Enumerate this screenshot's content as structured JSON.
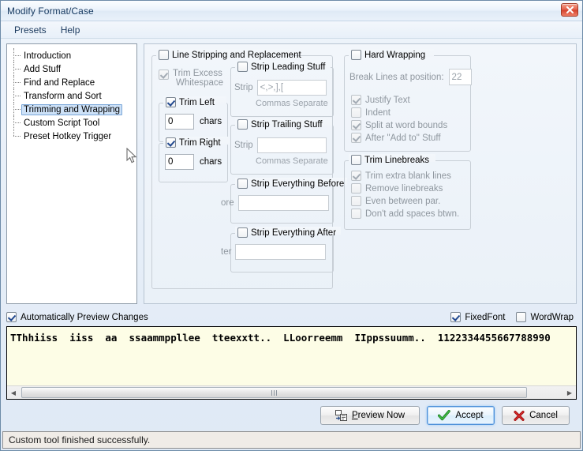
{
  "window": {
    "title": "Modify Format/Case",
    "close_label": "✕"
  },
  "menu": {
    "items": [
      "Presets",
      "Help"
    ]
  },
  "tree": {
    "items": [
      {
        "label": "Introduction",
        "selected": false
      },
      {
        "label": "Add Stuff",
        "selected": false
      },
      {
        "label": "Find and Replace",
        "selected": false
      },
      {
        "label": "Transform and Sort",
        "selected": false
      },
      {
        "label": "Trimming and Wrapping",
        "selected": true
      },
      {
        "label": "Custom Script Tool",
        "selected": false
      },
      {
        "label": "Preset Hotkey Trigger",
        "selected": false
      }
    ]
  },
  "groups": {
    "line_stripping": {
      "title": "Line Stripping and Replacement",
      "checked": false,
      "trim_excess": {
        "label_line1": "Trim Excess",
        "label_line2": "Whitespace",
        "checked": true,
        "enabled": false
      },
      "trim_left": {
        "title": "Trim Left",
        "checked": true,
        "value": "0",
        "unit": "chars"
      },
      "trim_right": {
        "title": "Trim Right",
        "checked": true,
        "value": "0",
        "unit": "chars"
      },
      "strip_leading": {
        "title": "Strip Leading Stuff",
        "checked": false,
        "field_label": "Strip",
        "value": "<,>,],[",
        "hint": "Commas Separate"
      },
      "strip_trailing": {
        "title": "Strip Trailing Stuff",
        "checked": false,
        "field_label": "Strip",
        "value": "",
        "hint": "Commas Separate"
      },
      "strip_before": {
        "title": "Strip Everything Before",
        "checked": false,
        "field_label": "ore",
        "value": ""
      },
      "strip_after": {
        "title": "Strip Everything After",
        "checked": false,
        "field_label": "ter",
        "value": ""
      }
    },
    "hard_wrapping": {
      "title": "Hard Wrapping",
      "checked": false,
      "break_label": "Break Lines at position:",
      "break_value": "22",
      "options": [
        {
          "label": "Justify Text",
          "checked": true
        },
        {
          "label": "Indent",
          "checked": false
        },
        {
          "label": "Split at word bounds",
          "checked": true
        },
        {
          "label": "After \"Add to\" Stuff",
          "checked": true
        }
      ]
    },
    "trim_linebreaks": {
      "title": "Trim Linebreaks",
      "checked": false,
      "options": [
        {
          "label": "Trim extra blank lines",
          "checked": true
        },
        {
          "label": "Remove linebreaks",
          "checked": false
        },
        {
          "label": "Even between par.",
          "checked": false
        },
        {
          "label": "Don't add spaces btwn.",
          "checked": false
        }
      ]
    }
  },
  "preview": {
    "auto_preview": {
      "label": "Automatically Preview Changes",
      "checked": true
    },
    "fixed_font": {
      "label": "FixedFont",
      "checked": true
    },
    "word_wrap": {
      "label": "WordWrap",
      "checked": false
    },
    "text": "TThhiiss  iiss  aa  ssaammppllee  tteexxtt..  LLoorreemm  IIppssuumm..  1122334455667788990"
  },
  "buttons": {
    "preview": {
      "accel": "P",
      "rest": "review Now"
    },
    "accept": "Accept",
    "cancel": "Cancel"
  },
  "statusbar": {
    "text": "Custom tool finished successfully."
  },
  "colors": {
    "accent": "#4d90d9",
    "preview_bg": "#fdfde6",
    "close_red": "#d4412c",
    "selection": "#cde1f7"
  }
}
